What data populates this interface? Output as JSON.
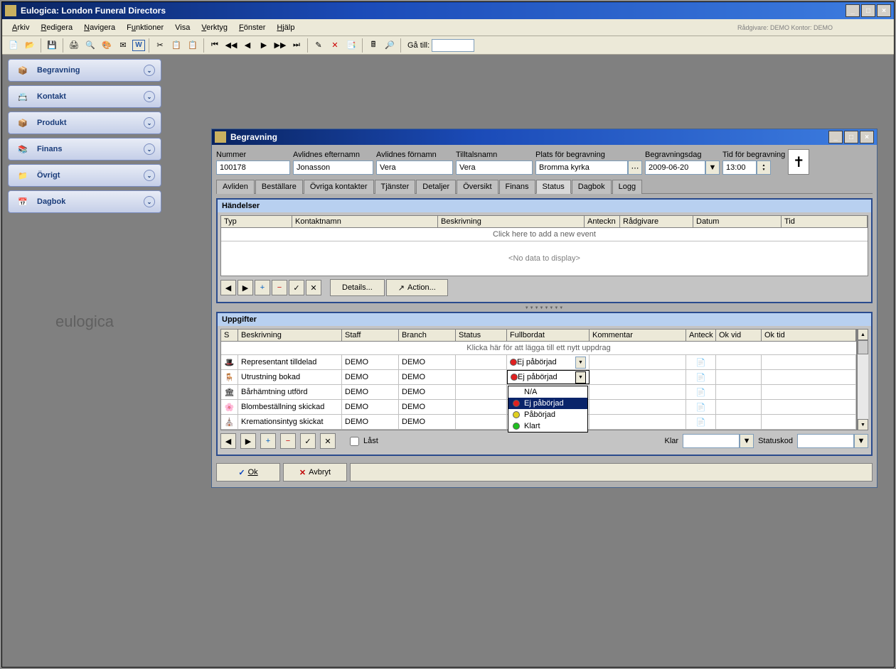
{
  "main_title": "Eulogica: London Funeral Directors",
  "menu": {
    "arkiv": "Arkiv",
    "redigera": "Redigera",
    "navigera": "Navigera",
    "funktioner": "Funktioner",
    "visa": "Visa",
    "verktyg": "Verktyg",
    "fonster": "Fönster",
    "hjalp": "Hjälp",
    "status": "Rådgivare: DEMO   Kontor: DEMO"
  },
  "toolbar": {
    "goto_label": "Gå till:",
    "goto_value": ""
  },
  "sidebar": [
    {
      "label": "Begravning"
    },
    {
      "label": "Kontakt"
    },
    {
      "label": "Produkt"
    },
    {
      "label": "Finans"
    },
    {
      "label": "Övrigt"
    },
    {
      "label": "Dagbok"
    }
  ],
  "logo": "eulogica",
  "inner_title": "Begravning",
  "header": {
    "nummer_label": "Nummer",
    "nummer": "100178",
    "efternamn_label": "Avlidnes efternamn",
    "efternamn": "Jonasson",
    "fornamn_label": "Avlidnes förnamn",
    "fornamn": "Vera",
    "tilltalsnamn_label": "Tilltalsnamn",
    "tilltalsnamn": "Vera",
    "plats_label": "Plats för begravning",
    "plats": "Bromma kyrka",
    "dag_label": "Begravningsdag",
    "dag": "2009-06-20",
    "tid_label": "Tid för begravning",
    "tid": "13:00"
  },
  "tabs": [
    "Avliden",
    "Beställare",
    "Övriga kontakter",
    "Tjänster",
    "Detaljer",
    "Översikt",
    "Finans",
    "Status",
    "Dagbok",
    "Logg"
  ],
  "active_tab": "Status",
  "handelser": {
    "title": "Händelser",
    "cols": [
      "Typ",
      "Kontaktnamn",
      "Beskrivning",
      "Anteckn",
      "Rådgivare",
      "Datum",
      "Tid"
    ],
    "addrow": "Click here to add a new event",
    "nodata": "<No data to display>",
    "details_btn": "Details...",
    "action_btn": "Action..."
  },
  "uppgifter": {
    "title": "Uppgifter",
    "cols": [
      "S",
      "Beskrivning",
      "Staff",
      "Branch",
      "Status",
      "Fullbordat",
      "Kommentar",
      "Anteck",
      "Ok vid",
      "Ok tid"
    ],
    "addrow": "Klicka här för att lägga till ett nytt uppdrag",
    "rows": [
      {
        "beskrivning": "Representant tilldelad",
        "staff": "DEMO",
        "branch": "DEMO",
        "fullbordat": "Ej påbörjad"
      },
      {
        "beskrivning": "Utrustning bokad",
        "staff": "DEMO",
        "branch": "DEMO",
        "fullbordat": "Ej påbörjad"
      },
      {
        "beskrivning": "Bårhämtning utförd",
        "staff": "DEMO",
        "branch": "DEMO",
        "fullbordat": ""
      },
      {
        "beskrivning": "Blombeställning skickad",
        "staff": "DEMO",
        "branch": "DEMO",
        "fullbordat": ""
      },
      {
        "beskrivning": "Kremationsintyg skickat",
        "staff": "DEMO",
        "branch": "DEMO",
        "fullbordat": ""
      }
    ],
    "last_checkbox": "Låst",
    "klar_label": "Klar",
    "statuskod_label": "Statuskod"
  },
  "dropdown_options": [
    {
      "label": "N/A",
      "color": ""
    },
    {
      "label": "Ej påbörjad",
      "color": "red",
      "selected": true
    },
    {
      "label": "Påbörjad",
      "color": "yellow"
    },
    {
      "label": "Klart",
      "color": "green"
    }
  ],
  "buttons": {
    "ok": "Ok",
    "avbryt": "Avbryt"
  }
}
